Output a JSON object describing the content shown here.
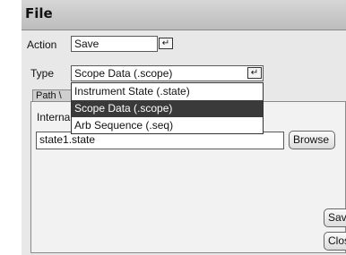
{
  "window": {
    "title": "File"
  },
  "action": {
    "label": "Action",
    "value": "Save"
  },
  "type": {
    "label": "Type",
    "value": "Scope Data (.scope)"
  },
  "type_options": [
    {
      "label": "Instrument State (.state)",
      "selected": false
    },
    {
      "label": "Scope Data (.scope)",
      "selected": true
    },
    {
      "label": "Arb Sequence (.seq)",
      "selected": false
    }
  ],
  "tabs": {
    "path_label": "Path \\"
  },
  "panel": {
    "internal_label": "Interna",
    "filename": "state1.state",
    "browse_label": "Browse"
  },
  "buttons": {
    "save_label": "Save",
    "close_label": "Close"
  },
  "icons": {
    "enter": "↵"
  }
}
